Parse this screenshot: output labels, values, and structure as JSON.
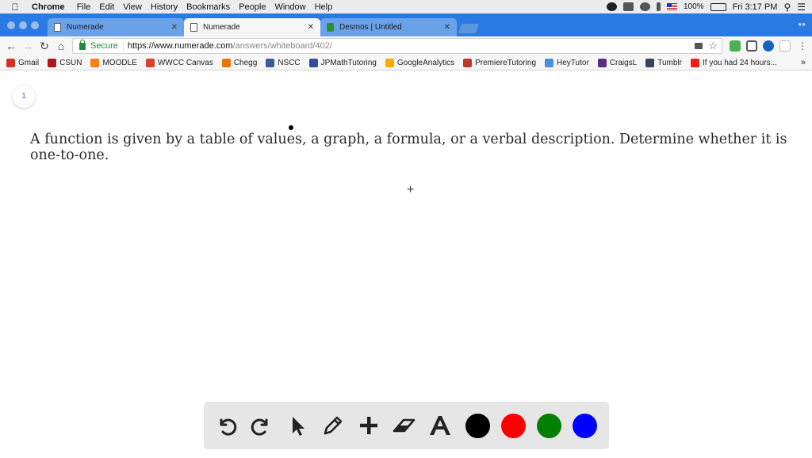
{
  "menubar": {
    "app_name": "Chrome",
    "menus": [
      "File",
      "Edit",
      "View",
      "History",
      "Bookmarks",
      "People",
      "Window",
      "Help"
    ],
    "battery": "100%",
    "clock": "Fri 3:17 PM"
  },
  "tabs": [
    {
      "title": "Numerade",
      "active": false
    },
    {
      "title": "Numerade",
      "active": true
    },
    {
      "title": "Desmos | Untitled",
      "active": false
    }
  ],
  "address_bar": {
    "secure_label": "Secure",
    "url_base": "https://www.numerade.com",
    "url_path": "/answers/whiteboard/402/"
  },
  "bookmarks": [
    {
      "label": "Gmail",
      "icon": "gmail-icon",
      "color": "#d93025"
    },
    {
      "label": "CSUN",
      "icon": "csun-icon",
      "color": "#b0171f"
    },
    {
      "label": "MOODLE",
      "icon": "moodle-icon",
      "color": "#f98012"
    },
    {
      "label": "WWCC Canvas",
      "icon": "canvas-icon",
      "color": "#e13f2b"
    },
    {
      "label": "Chegg",
      "icon": "chegg-icon",
      "color": "#eb7100"
    },
    {
      "label": "NSCC",
      "icon": "nscc-icon",
      "color": "#3c5a99"
    },
    {
      "label": "JPMathTutoring",
      "icon": "jpmath-icon",
      "color": "#2d4f9e"
    },
    {
      "label": "GoogleAnalytics",
      "icon": "analytics-icon",
      "color": "#f9ab00"
    },
    {
      "label": "PremiereTutoring",
      "icon": "premiere-icon",
      "color": "#c0392b"
    },
    {
      "label": "HeyTutor",
      "icon": "heytutor-icon",
      "color": "#4a90d9"
    },
    {
      "label": "CraigsL",
      "icon": "peace-icon",
      "color": "#5b2c83"
    },
    {
      "label": "Tumblr",
      "icon": "tumblr-icon",
      "color": "#35465c"
    },
    {
      "label": "If you had 24 hours...",
      "icon": "youtube-icon",
      "color": "#e62117"
    }
  ],
  "whiteboard": {
    "page_number": "1",
    "question": "A function is given by a table of values, a graph, a formula, or a verbal description. Determine whether it is one-to-one.",
    "colors": [
      "#000000",
      "#ff0000",
      "#008000",
      "#0000ff"
    ]
  }
}
